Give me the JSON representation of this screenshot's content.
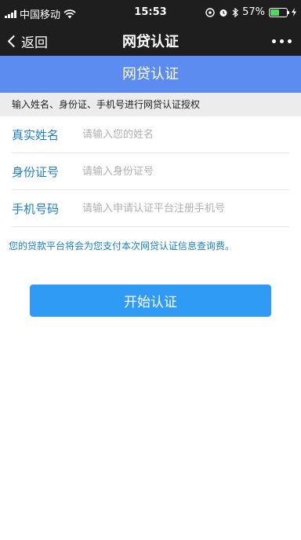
{
  "status_bar": {
    "carrier": "中国移动",
    "time": "15:53",
    "battery_percent": "57%",
    "battery_level": 0.57,
    "icons": [
      "signal-icon",
      "wifi-icon",
      "location-icon",
      "alarm-icon",
      "bluetooth-icon",
      "battery-icon",
      "charging-icon"
    ]
  },
  "nav": {
    "back_label": "返回",
    "title": "网贷认证"
  },
  "banner": {
    "title": "网贷认证"
  },
  "notice": {
    "text": "输入姓名、身份证、手机号进行网贷认证授权"
  },
  "form": {
    "name": {
      "label": "真实姓名",
      "placeholder": "请输入您的姓名",
      "value": ""
    },
    "id_card": {
      "label": "身份证号",
      "placeholder": "请输入身份证号",
      "value": ""
    },
    "phone": {
      "label": "手机号码",
      "placeholder": "请输入申请认证平台注册手机号",
      "value": ""
    }
  },
  "tip": {
    "text": "您的贷款平台将会为您支付本次网贷认证信息查询费。"
  },
  "start_button": {
    "label": "开始认证"
  },
  "colors": {
    "banner": "#5c8cf0",
    "label_blue": "#1c7fc8",
    "button": "#2f9bf5",
    "bar_dark": "#1e1e1e"
  }
}
